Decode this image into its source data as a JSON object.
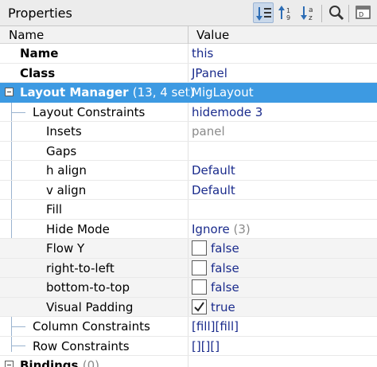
{
  "panel": {
    "title": "Properties",
    "toolbar": {
      "icons": [
        "sort-by-category-icon",
        "sort-ascending-icon",
        "sort-alphabetical-icon",
        "search-icon",
        "customize-icon"
      ]
    }
  },
  "table": {
    "headers": {
      "name": "Name",
      "value": "Value"
    },
    "rows": [
      {
        "name": "Name",
        "value": "this"
      },
      {
        "name": "Class",
        "value": "JPanel"
      },
      {
        "name": "Layout Manager",
        "count": "(13, 4 set)",
        "value": "MigLayout"
      },
      {
        "name": "Layout Constraints",
        "value": "hidemode 3"
      },
      {
        "name": "Insets",
        "value": "panel"
      },
      {
        "name": "Gaps",
        "value": ""
      },
      {
        "name": "h align",
        "value": "Default"
      },
      {
        "name": "v align",
        "value": "Default"
      },
      {
        "name": "Fill",
        "value": ""
      },
      {
        "name": "Hide Mode",
        "value": "Ignore",
        "extra": "(3)"
      },
      {
        "name": "Flow Y",
        "value": "false",
        "checked": false
      },
      {
        "name": "right-to-left",
        "value": "false",
        "checked": false
      },
      {
        "name": "bottom-to-top",
        "value": "false",
        "checked": false
      },
      {
        "name": "Visual Padding",
        "value": "true",
        "checked": true
      },
      {
        "name": "Column Constraints",
        "value": "[fill][fill]"
      },
      {
        "name": "Row Constraints",
        "value": "[][][]"
      },
      {
        "name": "Bindings",
        "count": "(0)"
      }
    ]
  },
  "colors": {
    "selection": "#3d9ae2",
    "value_text": "#1a2b8c"
  }
}
